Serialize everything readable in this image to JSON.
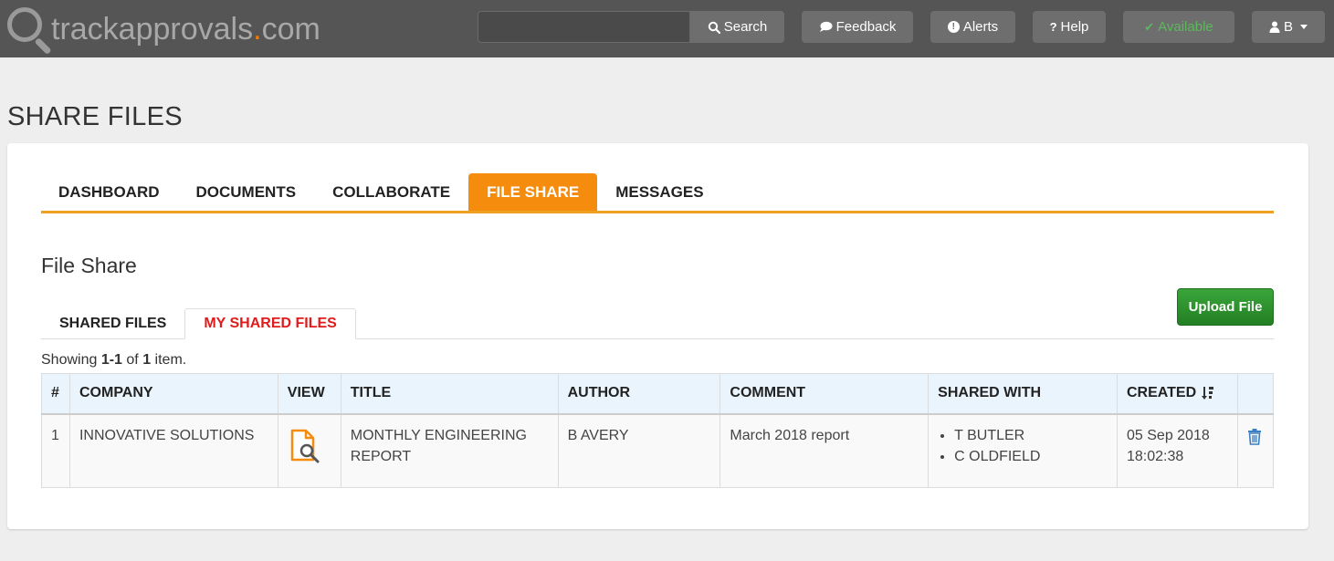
{
  "header": {
    "logo_text_a": "trackapprovals",
    "logo_dot": ".",
    "logo_text_b": "com",
    "search": {
      "placeholder": "",
      "button_label": "Search"
    },
    "buttons": {
      "feedback": "Feedback",
      "alerts": "Alerts",
      "help": "Help",
      "available": "Available",
      "user": "B"
    }
  },
  "page": {
    "title": "SHARE FILES"
  },
  "main_nav": {
    "items": [
      {
        "label": "DASHBOARD"
      },
      {
        "label": "DOCUMENTS"
      },
      {
        "label": "COLLABORATE"
      },
      {
        "label": "FILE SHARE"
      },
      {
        "label": "MESSAGES"
      }
    ],
    "active": "FILE SHARE"
  },
  "section": {
    "title": "File Share",
    "upload_label": "Upload File",
    "subtabs": [
      {
        "label": "SHARED FILES"
      },
      {
        "label": "MY SHARED FILES"
      }
    ],
    "active_subtab": "MY SHARED FILES"
  },
  "summary": {
    "prefix": "Showing ",
    "range": "1-1",
    "middle": " of ",
    "total": "1",
    "suffix": " item."
  },
  "table": {
    "columns": [
      "#",
      "COMPANY",
      "VIEW",
      "TITLE",
      "AUTHOR",
      "COMMENT",
      "SHARED WITH",
      "CREATED",
      ""
    ],
    "rows": [
      {
        "num": "1",
        "company": "INNOVATIVE SOLUTIONS",
        "title": "MONTHLY ENGINEERING REPORT",
        "author": "B AVERY",
        "comment": "March 2018 report",
        "shared_with": [
          "T BUTLER",
          "C OLDFIELD"
        ],
        "created_date": "05 Sep 2018",
        "created_time": "18:02:38"
      }
    ]
  },
  "colors": {
    "topbar": "#555555",
    "accent_orange": "#f68c0d",
    "active_subtab": "#e01b1b",
    "upload_green": "#2e8b2e",
    "available_green": "#5cb85c",
    "table_header": "#eaf4fc"
  },
  "icons": {
    "logo": "magnifier-icon",
    "search": "search-icon",
    "feedback": "speech-bubble-icon",
    "alerts": "exclamation-circle-icon",
    "help": "question-icon",
    "available": "check-icon",
    "user": "user-icon",
    "view": "document-search-icon",
    "delete": "trash-icon",
    "sort": "sort-desc-icon"
  }
}
